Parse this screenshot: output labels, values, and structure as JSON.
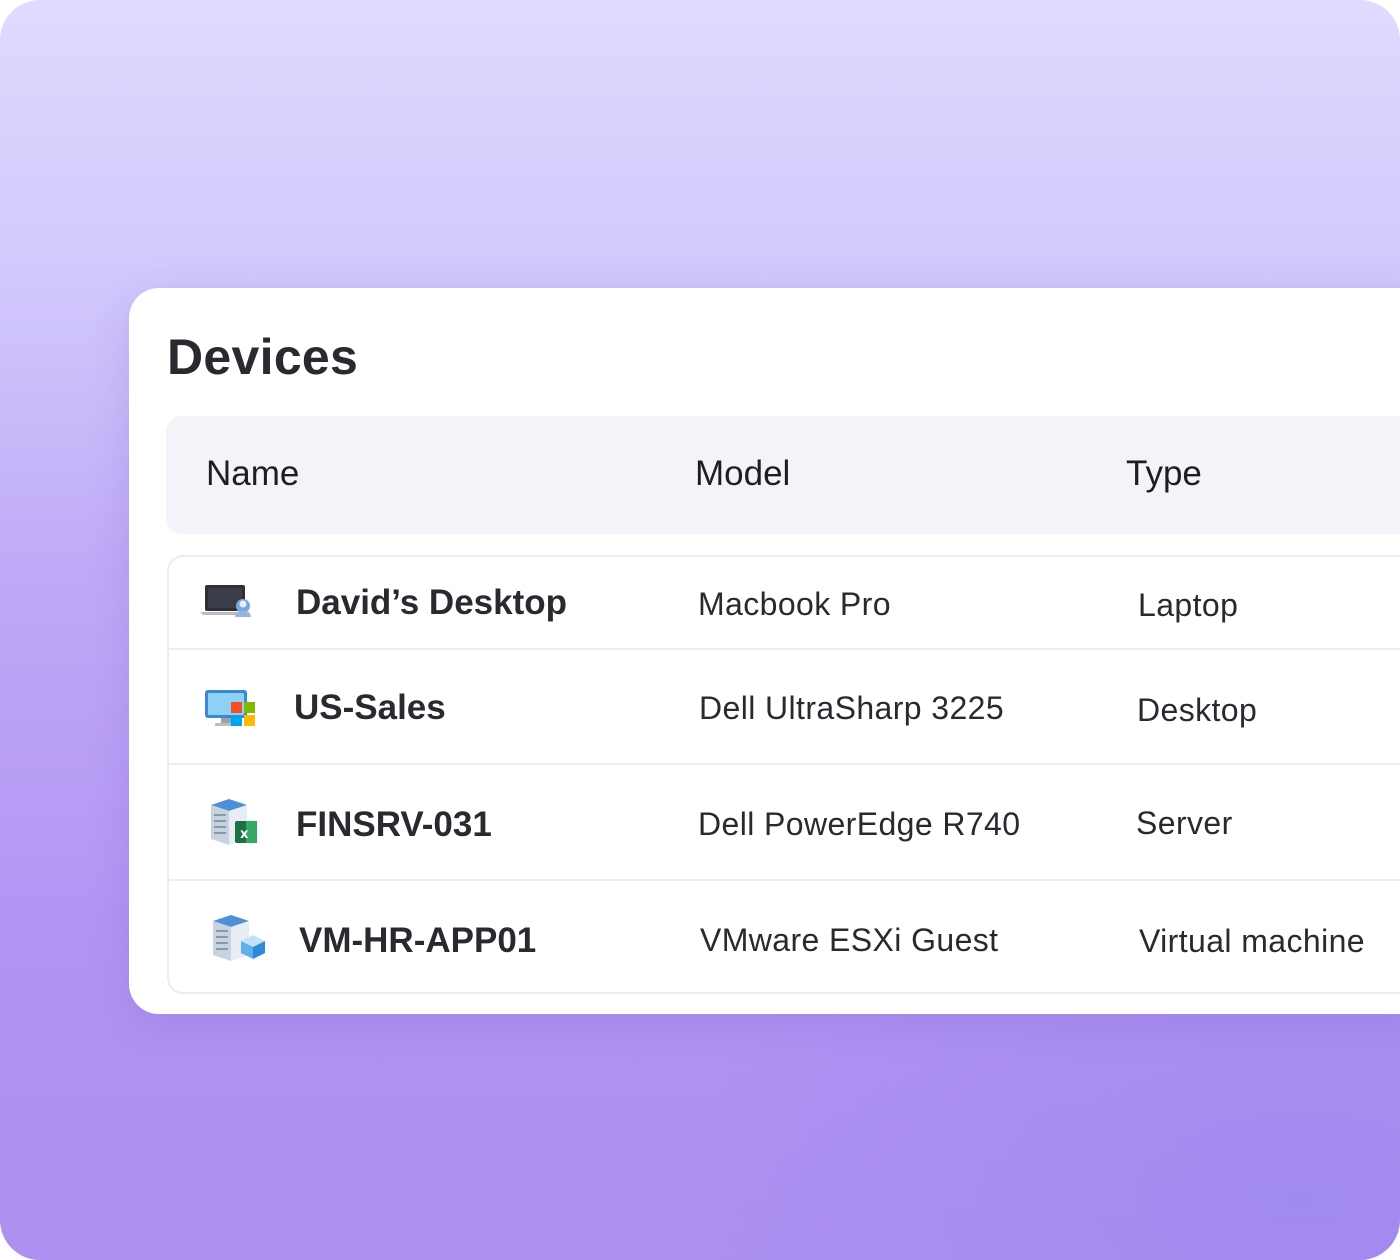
{
  "page": {
    "title": "Devices"
  },
  "table": {
    "columns": [
      "Name",
      "Model",
      "Type"
    ],
    "rows": [
      {
        "name": "David’s Desktop",
        "model": "Macbook Pro",
        "type": "Laptop",
        "icon": "laptop-user-icon"
      },
      {
        "name": "US-Sales",
        "model": "Dell UltraSharp 3225",
        "type": "Desktop",
        "icon": "desktop-windows-icon"
      },
      {
        "name": "FINSRV-031",
        "model": "Dell PowerEdge R740",
        "type": "Server",
        "icon": "server-excel-icon"
      },
      {
        "name": "VM-HR-APP01",
        "model": "VMware ESXi Guest",
        "type": "Virtual machine",
        "icon": "server-vm-icon"
      }
    ]
  },
  "colors": {
    "background_top": "#dfdafe",
    "background_bottom": "#ac91f0",
    "card": "#ffffff",
    "header_bg": "#f5f2f9",
    "text": "#2b2930"
  }
}
